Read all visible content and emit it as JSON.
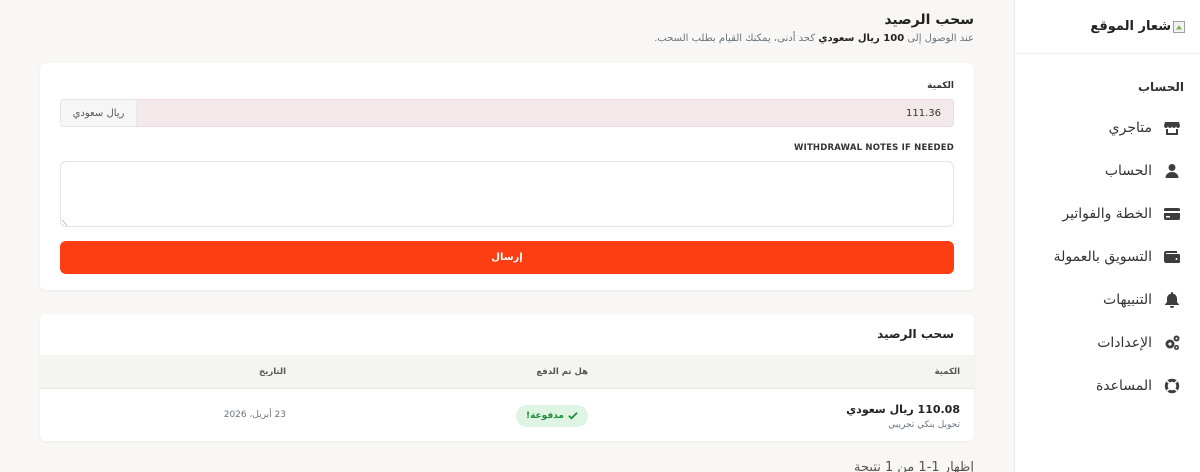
{
  "sidebar": {
    "logo_text": "شعار الموقع",
    "section_label": "الحساب",
    "items": [
      {
        "label": "متاجري",
        "icon": "store-icon"
      },
      {
        "label": "الحساب",
        "icon": "user-icon"
      },
      {
        "label": "الخطة والفواتير",
        "icon": "credit-card-icon"
      },
      {
        "label": "التسويق بالعمولة",
        "icon": "wallet-icon"
      },
      {
        "label": "التنبيهات",
        "icon": "bell-icon"
      },
      {
        "label": "الإعدادات",
        "icon": "gears-icon"
      },
      {
        "label": "المساعدة",
        "icon": "lifering-icon"
      }
    ]
  },
  "header": {
    "title": "سحب الرصيد",
    "subtitle_prefix": "عند الوصول إلى ",
    "subtitle_amount": "100 ريال سعودي",
    "subtitle_suffix": " كحد أدنى، يمكنك القيام بطلب السحب."
  },
  "form": {
    "amount_label": "الكمية",
    "amount_value": "111.36",
    "currency": "ريال سعودي",
    "notes_label": "WITHDRAWAL NOTES IF NEEDED",
    "notes_value": "",
    "submit_label": "إرسال"
  },
  "history": {
    "title": "سحب الرصيد",
    "columns": [
      "الكمية",
      "هل تم الدفع",
      "التاريخ"
    ],
    "rows": [
      {
        "amount": "110.08 ريال سعودي",
        "method": "تحويل بنكي تجريبي",
        "status": "مدفوعة!",
        "date": "23 أبريل، 2026"
      }
    ]
  },
  "pagination": {
    "text": "إظهار 1-1 من 1 نتيجة"
  },
  "colors": {
    "accent": "#ff3d12",
    "paid_bg": "#dff5e3",
    "paid_fg": "#1f8a3a"
  }
}
